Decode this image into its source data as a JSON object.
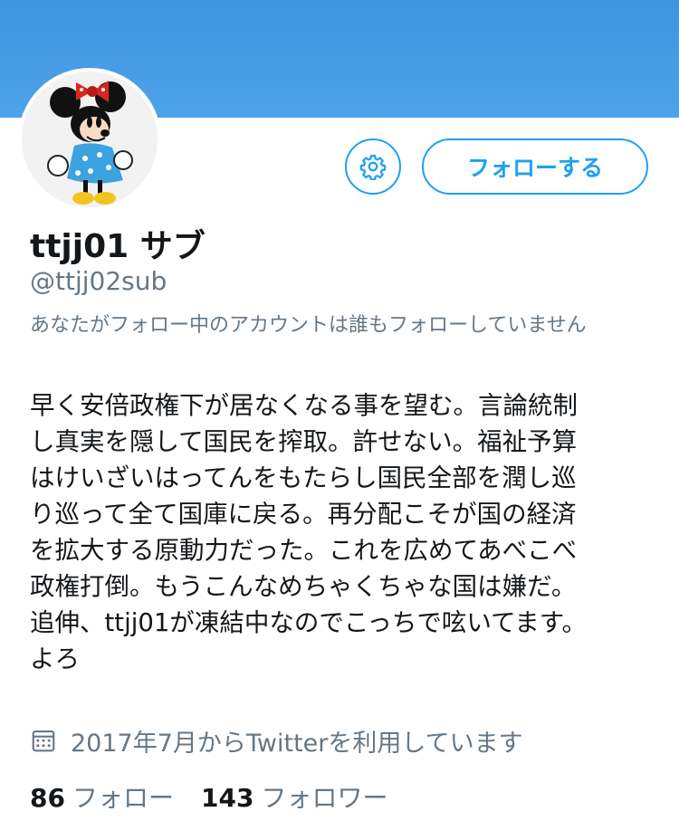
{
  "profile": {
    "display_name": "ttjj01 サブ",
    "handle": "@ttjj02sub",
    "context": "あなたがフォロー中のアカウントは誰もフォローしていません",
    "bio_lines": [
      "早く安倍政権下が居なくなる事を望む。言論統制",
      "し真実を隠して国民を搾取。許せない。福祉予算",
      "はけいざいはってんをもたらし国民全部を潤し巡",
      "り巡って全て国庫に戻る。再分配こそが国の経済",
      "を拡大する原動力だった。これを広めてあべこべ",
      "政権打倒。もうこんなめちゃくちゃな国は嫌だ。",
      "追伸、ttjj01が凍結中なのでこっちで呟いてます。",
      "よろ"
    ],
    "joined": "2017年7月からTwitterを利用しています",
    "following_count": "86",
    "following_label": "フォロー",
    "followers_count": "143",
    "followers_label": "フォロワー"
  },
  "actions": {
    "follow_label": "フォローする",
    "settings_icon": "gear-icon"
  },
  "colors": {
    "accent": "#1da1f2",
    "banner": "#4a9fe8",
    "secondary_text": "#657786",
    "primary_text": "#14171a"
  }
}
